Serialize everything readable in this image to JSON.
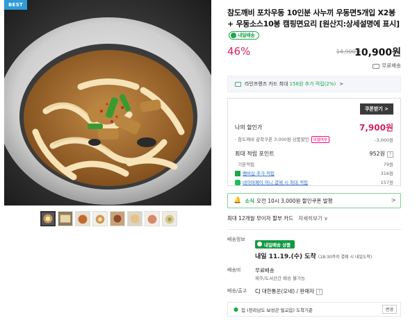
{
  "badge": "BEST",
  "product": {
    "title": "참도깨비 포차우동 10인분 사누끼 우동면5개입 X2봉 + 우동소스10봉 캠핑면요리 [원산지:상세설명에 표시]",
    "delivery_tag": "내일배송",
    "discount": "46%",
    "original_price": "14,900원",
    "sale_price": "10,900원",
    "shipping": "무료배송"
  },
  "card_banner": {
    "text_a": "라인프렌즈 카드 최대 ",
    "text_hl": "158원 추가 적립(2%)",
    "text_chev": ">"
  },
  "coupon": {
    "button": "쿠폰받기 >",
    "my_discount_label": "나의 할인가",
    "my_discount_price": "7,900원",
    "coupon_desc": "참도깨비 감착쿠폰 3,000원 상품할인",
    "coupon_tag": "모델여부",
    "coupon_amount": "-3,000원",
    "points_label": "최대 적립 포인트",
    "points_total": "952원",
    "q": "?",
    "rows": [
      {
        "label": "기본적립",
        "value": "79원"
      },
      {
        "label": "멤버십 추가 적립",
        "value": "316원"
      },
      {
        "label": "네이버페이 머니 결제 시 최대 적립",
        "value": "157원"
      }
    ]
  },
  "notice": {
    "bell": "🔔",
    "green": "소식",
    "text": "오전 10시 3,000원 할인쿠폰 발행",
    "chev": ">"
  },
  "installment": {
    "text": "최대 12개월 무이자 할부 카드",
    "more": "자세히보기 ∨"
  },
  "shipping_info": {
    "key1": "배송정보",
    "rocket": "내일배송 상품",
    "arrive": "내일 11.19.(수) 도착",
    "arrive_note": "(18:30까지 결제 시 내일도착)",
    "key2": "배송비",
    "fee": "무료배송",
    "fee_note": "제주/도서산간 배송 불가능",
    "key3": "배송/출고",
    "carrier": "CJ 대한통운(오네) / 판매자",
    "q": "?"
  },
  "location": {
    "text": "집 (전라남도 보성군 벌교읍) 도착기준",
    "change": "변경"
  },
  "colors": {
    "accent": "#1aa84a",
    "red": "#d6245a",
    "blue": "#2f9bd8"
  }
}
